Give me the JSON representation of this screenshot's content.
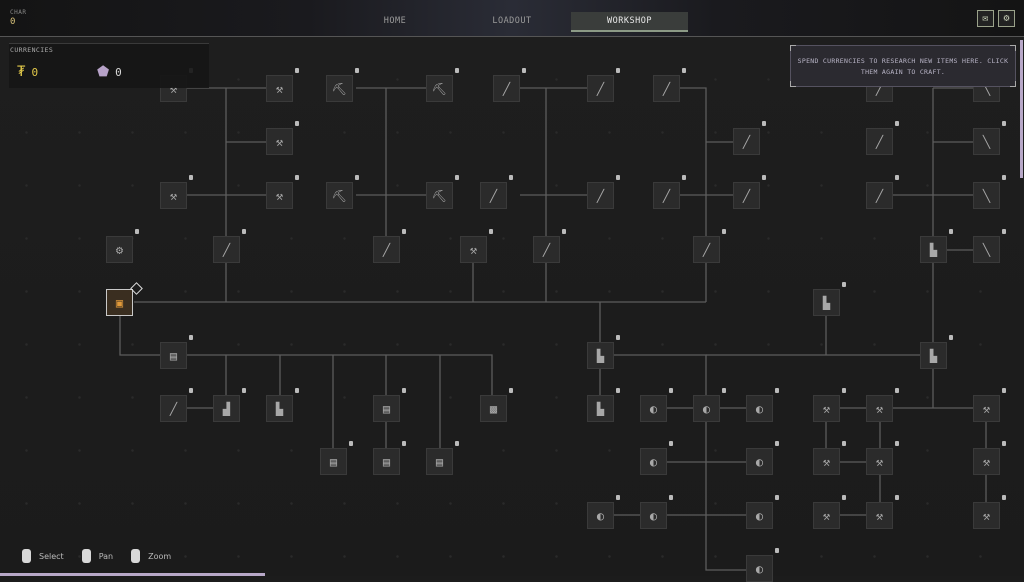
{
  "header": {
    "char_label": "CHAR",
    "char_value": "0",
    "tabs": [
      {
        "label": "HOME"
      },
      {
        "label": "LOADOUT"
      },
      {
        "label": "WORKSHOP"
      }
    ],
    "active_tab": "WORKSHOP",
    "icons": [
      "mail-icon",
      "gear-icon"
    ]
  },
  "currencies": {
    "label": "CURRENCIES",
    "items": [
      {
        "icon": "gold-currency-icon",
        "value": "0",
        "color": "#e2c94a"
      },
      {
        "icon": "crystal-currency-icon",
        "value": "0",
        "color": "#b7a2c8"
      }
    ]
  },
  "hint": {
    "text": "SPEND CURRENCIES TO RESEARCH NEW ITEMS HERE. CLICK THEM AGAIN TO CRAFT."
  },
  "controls": [
    {
      "label": "Select",
      "icon": "mouse-left-icon"
    },
    {
      "label": "Pan",
      "icon": "mouse-right-icon"
    },
    {
      "label": "Zoom",
      "icon": "mouse-scroll-icon"
    }
  ],
  "tree": {
    "root_item": "crafting-bench-icon",
    "item_icons": [
      "hammer-icon",
      "axe-icon",
      "spear-icon",
      "sword-icon",
      "club-icon",
      "gauntlet-icon",
      "shield-icon",
      "tool-icon",
      "armor-icon"
    ]
  }
}
